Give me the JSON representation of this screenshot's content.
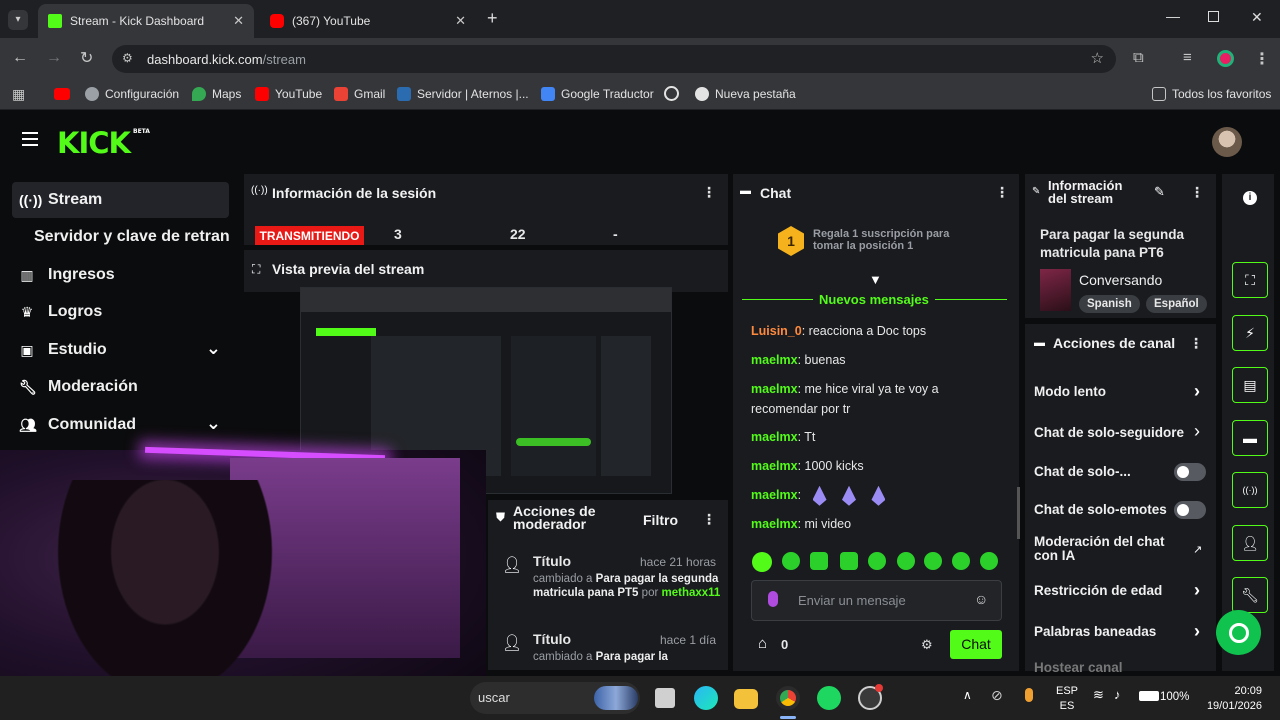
{
  "browser": {
    "tabs": [
      {
        "title": "Stream - Kick Dashboard",
        "active": true
      },
      {
        "title": "(367) YouTube",
        "active": false
      }
    ],
    "url_domain": "dashboard.kick.com",
    "url_path": "/stream",
    "bookmarks": [
      "Configuración",
      "Maps",
      "YouTube",
      "Gmail",
      "Servidor | Aternos |...",
      "Google Traductor",
      "Nueva pestaña"
    ],
    "all_bookmarks": "Todos los favoritos"
  },
  "kick": {
    "logo": "KICK",
    "beta": "BETA",
    "sidebar": {
      "items": [
        {
          "label": "Stream",
          "icon": "broadcast-icon"
        },
        {
          "label": "Servidor y clave de retransm",
          "icon": ""
        },
        {
          "label": "Ingresos",
          "icon": "chart-icon"
        },
        {
          "label": "Logros",
          "icon": "trophy-icon"
        },
        {
          "label": "Estudio",
          "icon": "studio-icon"
        },
        {
          "label": "Moderación",
          "icon": "wrench-icon"
        },
        {
          "label": "Comunidad",
          "icon": "community-icon"
        }
      ]
    },
    "session": {
      "title": "Información de la sesión",
      "status": "TRANSMITIENDO",
      "stat1": "3",
      "stat2": "22",
      "stat3": "-"
    },
    "preview": {
      "title": "Vista previa del stream"
    },
    "mod_actions": {
      "title": "Acciones de moderador",
      "filter": "Filtro",
      "entries": [
        {
          "title": "Título",
          "time": "hace 21 horas",
          "prefix": "cambiado a",
          "value": "Para pagar la segunda matricula pana PT5",
          "by": "por",
          "user": "methaxx11"
        },
        {
          "title": "Título",
          "time": "hace 1 día",
          "prefix": "cambiado a",
          "value": "Para pagar la",
          "by": "",
          "user": ""
        }
      ]
    },
    "chat": {
      "title": "Chat",
      "gift_rank": "1",
      "gift_text": "Regala 1 suscripción para tomar la posición 1",
      "new_messages": "Nuevos mensajes",
      "messages": [
        {
          "user": "Luisin_0",
          "text": "reacciona a Doc tops",
          "color": "#ff8a3d"
        },
        {
          "user": "maelmx",
          "text": "buenas",
          "color": "#53fc18"
        },
        {
          "user": "maelmx",
          "text": "me hice viral ya te voy a recomendar por tr",
          "color": "#53fc18"
        },
        {
          "user": "maelmx",
          "text": "Tt",
          "color": "#53fc18"
        },
        {
          "user": "maelmx",
          "text": "1000 kicks",
          "color": "#53fc18"
        },
        {
          "user": "maelmx",
          "text": "",
          "color": "#53fc18"
        },
        {
          "user": "maelmx",
          "text": "mi video",
          "color": "#53fc18"
        }
      ],
      "input_placeholder": "Enviar un mensaje",
      "points": "0",
      "send_label": "Chat"
    },
    "stream_info": {
      "title": "Información del stream",
      "stream_title": "Para pagar la segunda matricula pana PT6",
      "category": "Conversando",
      "tags": [
        "Spanish",
        "Español"
      ]
    },
    "channel_actions": {
      "title": "Acciones de canal",
      "items": [
        {
          "label": "Modo lento",
          "control": "arrow"
        },
        {
          "label": "Chat de solo-seguidores",
          "control": "arrow"
        },
        {
          "label": "Chat de solo-...",
          "control": "toggle"
        },
        {
          "label": "Chat de solo-emotes",
          "control": "toggle"
        },
        {
          "label": "Moderación del chat con IA",
          "control": "external"
        },
        {
          "label": "Restricción de edad",
          "control": "arrow"
        },
        {
          "label": "Palabras baneadas",
          "control": "arrow"
        },
        {
          "label": "Hostear canal",
          "control": "none"
        }
      ]
    }
  },
  "taskbar": {
    "search": "uscar",
    "lang1": "ESP",
    "lang2": "ES",
    "battery": "100%",
    "time": "20:09",
    "date": "19/01/2026"
  },
  "colors": {
    "brand": "#53fc18",
    "live": "#e91916",
    "panel": "#191b1f"
  }
}
